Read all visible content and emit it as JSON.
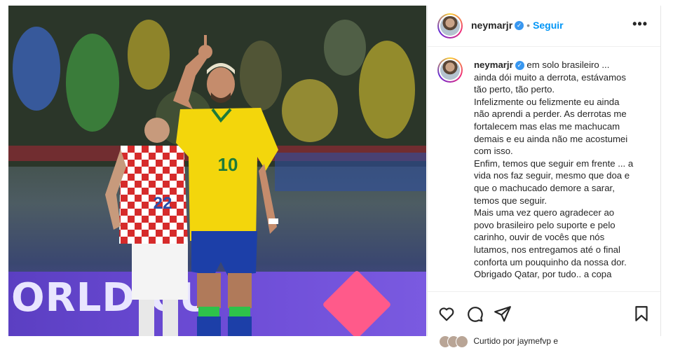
{
  "post": {
    "username": "neymarjr",
    "verified_badge": "✓",
    "separator": "•",
    "follow_label": "Seguir",
    "more_label": "•••",
    "caption_lines": [
      "em solo brasileiro ...",
      "ainda dói muito a derrota, estávamos",
      "tão perto, tão perto.",
      "Infelizmente ou felizmente eu ainda",
      "não aprendi a perder. As derrotas me",
      "fortalecem mas elas me machucam",
      "demais e eu ainda não me acostumei",
      "com isso.",
      "Enfim, temos que seguir em frente ... a",
      "vida nos faz seguir, mesmo que doa e",
      "que o machucado demore a sarar,",
      "temos que seguir.",
      "Mais uma vez quero agradecer ao",
      "povo brasileiro pelo suporte e pelo",
      "carinho, ouvir de vocês que nós",
      "lutamos, nos entregamos até o final",
      "conforta um pouquinho da nossa dor.",
      "Obrigado Qatar, por tudo.. a copa"
    ],
    "liked_by": "Curtido por jaymefvp e"
  },
  "photo": {
    "board_text": "ORLD CU",
    "jersey_number_brazil": "10",
    "jersey_number_croatia": "22"
  },
  "icons": {
    "like": "heart-icon",
    "comment": "comment-icon",
    "share": "share-icon",
    "save": "bookmark-icon"
  },
  "colors": {
    "follow": "#0095f6",
    "verified": "#3897f0",
    "brazil_yellow": "#f5d90a",
    "brazil_blue": "#1c3fa8",
    "board_purple": "#6a4bd4",
    "board_diamond": "#ff5a8a"
  }
}
